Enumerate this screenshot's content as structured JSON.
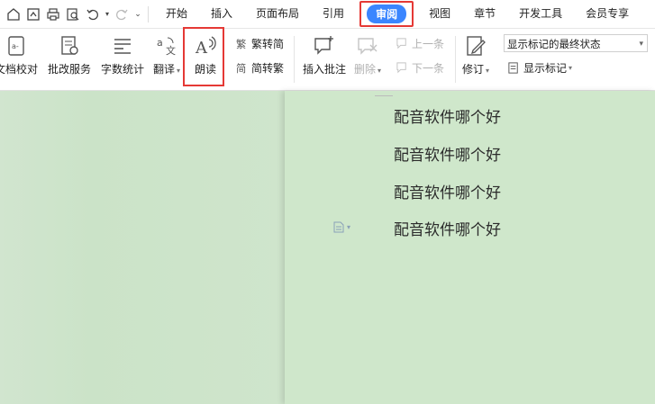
{
  "tabs": [
    "开始",
    "插入",
    "页面布局",
    "引用",
    "审阅",
    "视图",
    "章节",
    "开发工具",
    "会员专享"
  ],
  "active_tab": "审阅",
  "ribbon": {
    "doc_compare": "文档校对",
    "revise_service": "批改服务",
    "word_count": "字数统计",
    "translate": "翻译",
    "read_aloud": "朗读",
    "trad_to_simp": "繁转简",
    "simp_to_trad": "简转繁",
    "insert_comment": "插入批注",
    "delete": "删除",
    "prev": "上一条",
    "next": "下一条",
    "revise": "修订",
    "markup_state": "显示标记的最终状态",
    "show_markup": "显示标记"
  },
  "document": {
    "lines": [
      "配音软件哪个好",
      "配音软件哪个好",
      "配音软件哪个好",
      "配音软件哪个好"
    ]
  },
  "colors": {
    "highlight": "#e53935",
    "active_tab_bg": "#3b86ff",
    "page_bg": "#cfe7cb"
  }
}
